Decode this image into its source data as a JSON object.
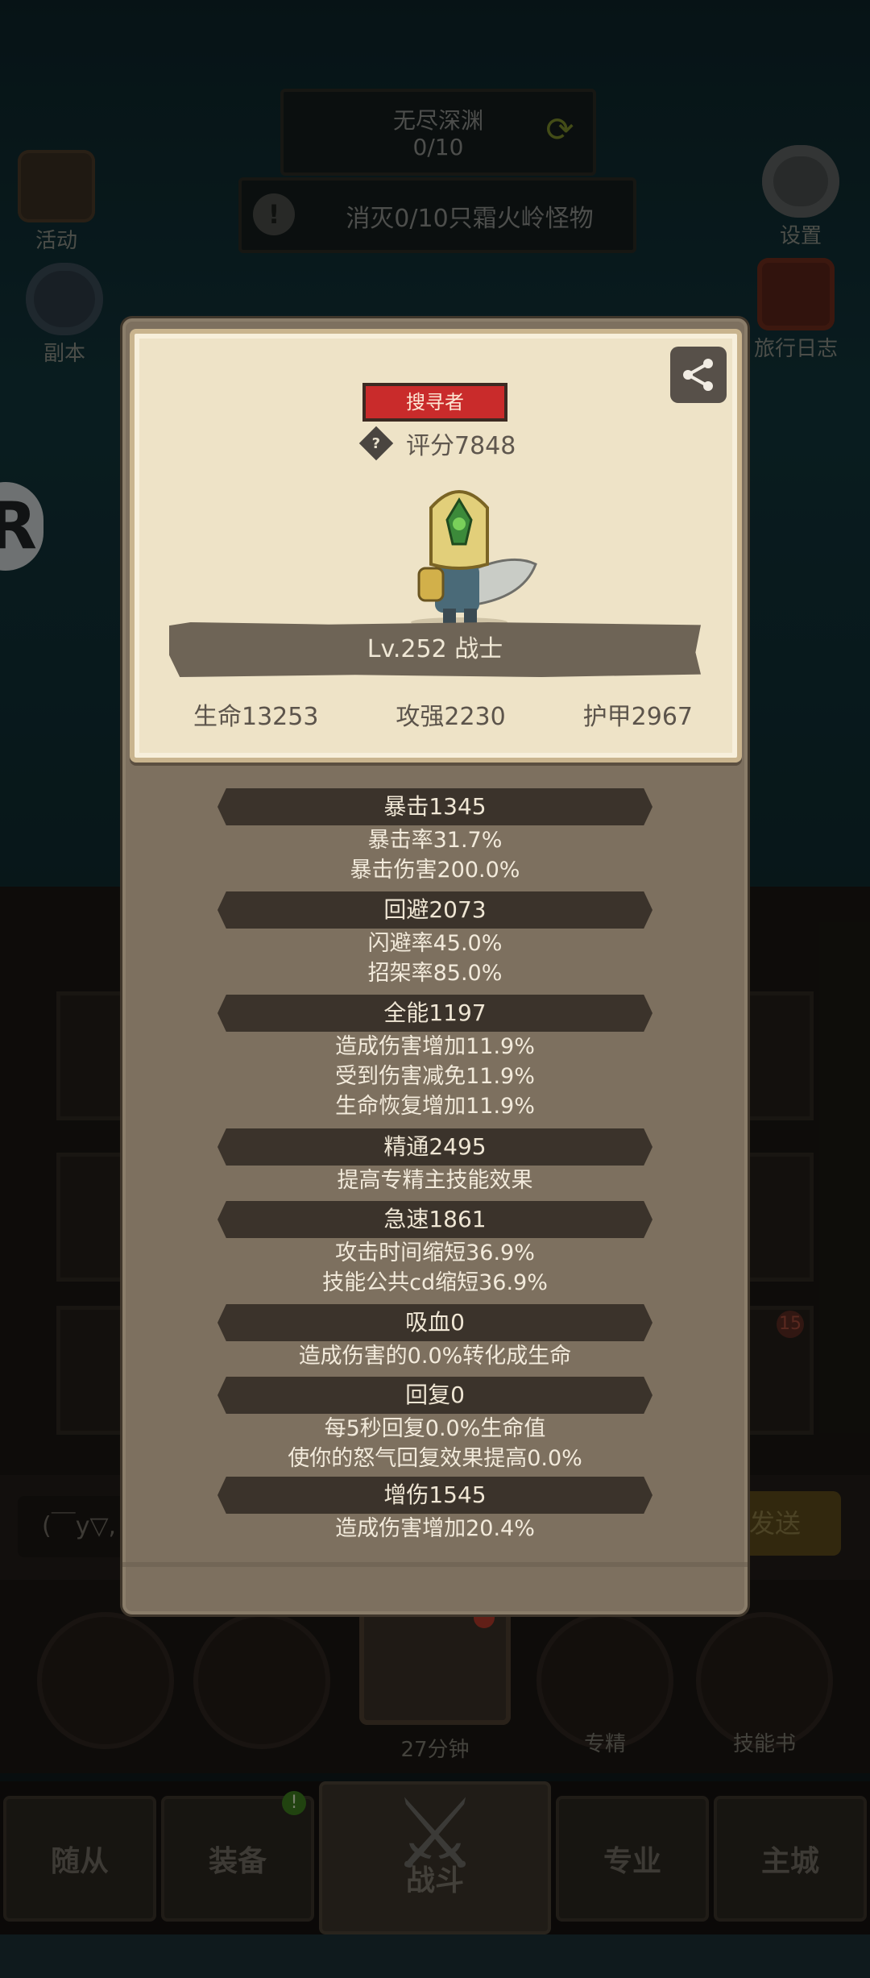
{
  "scene": {
    "quest_title": "无尽深渊",
    "quest_progress": "0/10",
    "kill_text": "消灭0/10只霜火岭怪物",
    "left_buttons": [
      "活动",
      "副本"
    ],
    "right_buttons": [
      "设置",
      "旅行日志"
    ]
  },
  "bottom": {
    "chest_timer": "27分钟",
    "specialize_label": "专精",
    "skillbook_label": "技能书",
    "chat_left": "(￣y▽,",
    "chat_send": "发送",
    "slot_badge": "15"
  },
  "nav": {
    "tabs": [
      "随从",
      "装备",
      "战斗",
      "专业",
      "主城"
    ],
    "equip_badge": "!"
  },
  "profile": {
    "title_badge": "搜寻者",
    "score": "评分7848",
    "level_class": "Lv.252 战士",
    "hp": "生命13253",
    "attack": "攻强2230",
    "armor": "护甲2967"
  },
  "stats": [
    {
      "name": "暴击1345",
      "lines": [
        "暴击率31.7%",
        "暴击伤害200.0%"
      ]
    },
    {
      "name": "回避2073",
      "lines": [
        "闪避率45.0%",
        "招架率85.0%"
      ]
    },
    {
      "name": "全能1197",
      "lines": [
        "造成伤害增加11.9%",
        "受到伤害减免11.9%",
        "生命恢复增加11.9%"
      ]
    },
    {
      "name": "精通2495",
      "lines": [
        "提高专精主技能效果"
      ]
    },
    {
      "name": "急速1861",
      "lines": [
        "攻击时间缩短36.9%",
        "技能公共cd缩短36.9%"
      ]
    },
    {
      "name": "吸血0",
      "lines": [
        "造成伤害的0.0%转化成生命"
      ]
    },
    {
      "name": "回复0",
      "lines": [
        "每5秒回复0.0%生命值",
        "使你的怒气回复效果提高0.0%"
      ]
    },
    {
      "name": "增伤1545",
      "lines": [
        "造成伤害增加20.4%"
      ]
    }
  ],
  "colors": {
    "title_badge": "#c92b2b",
    "panel": "#7d705f",
    "card": "#eee3c7",
    "stat_header": "#3b332b"
  },
  "icons": {
    "share": "share-icon",
    "help": "question-diamond-icon",
    "refresh": "refresh-icon",
    "warning": "exclamation-icon"
  }
}
